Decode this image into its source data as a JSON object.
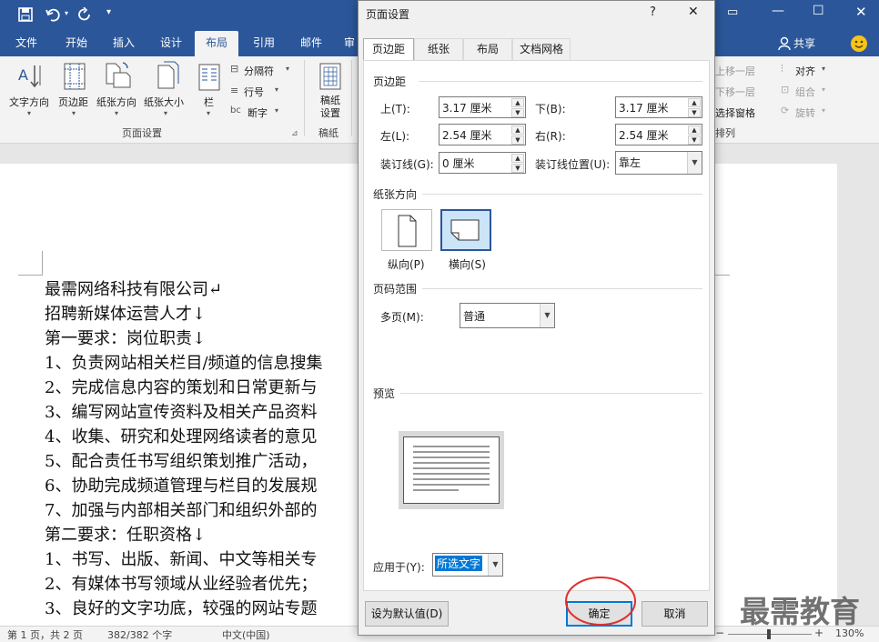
{
  "ribbon_tabs": [
    "文件",
    "开始",
    "插入",
    "设计",
    "布局",
    "引用",
    "邮件",
    "审阅"
  ],
  "share_label": "共享",
  "ribbon": {
    "text_direction": "文字方向",
    "margins": "页边距",
    "orientation": "纸张方向",
    "size": "纸张大小",
    "columns": "栏",
    "breaks": "分隔符",
    "line_numbers": "行号",
    "hyphenation": "断字",
    "manuscript": "稿纸设置",
    "group_page_setup": "页面设置",
    "group_manuscript": "稿纸",
    "bring_forward": "上移一层",
    "send_backward": "下移一层",
    "selection_pane": "选择窗格",
    "align": "对齐",
    "group": "组合",
    "rotate": "旋转",
    "group_arrange": "排列"
  },
  "document_lines": [
    "最需网络科技有限公司↵",
    "招聘新媒体运营人才↓",
    "第一要求：岗位职责↓",
    "1、负责网站相关栏目/频道的信息搜集",
    "2、完成信息内容的策划和日常更新与",
    "3、编写网站宣传资料及相关产品资料",
    "4、收集、研究和处理网络读者的意见",
    "5、配合责任书写组织策划推广活动，",
    "6、协助完成频道管理与栏目的发展规",
    "7、加强与内部相关部门和组织外部的",
    "第二要求：任职资格↓",
    "1、书写、出版、新闻、中文等相关专",
    "2、有媒体书写领域从业经验者优先；",
    "3、良好的文字功底，较强的网站专题"
  ],
  "status": {
    "page": "第 1 页，共 2 页",
    "words": "382/382 个字",
    "language": "中文(中国)",
    "zoom": "130%",
    "minus": "−",
    "plus": "+"
  },
  "watermark": "最需教育",
  "dialog": {
    "title": "页面设置",
    "help": "?",
    "close": "✕",
    "tabs": [
      "页边距",
      "纸张",
      "布局",
      "文档网格"
    ],
    "margins_section": "页边距",
    "top_label": "上(T):",
    "top_value": "3.17 厘米",
    "bottom_label": "下(B):",
    "bottom_value": "3.17 厘米",
    "left_label": "左(L):",
    "left_value": "2.54 厘米",
    "right_label": "右(R):",
    "right_value": "2.54 厘米",
    "gutter_label": "装订线(G):",
    "gutter_value": "0 厘米",
    "gutter_pos_label": "装订线位置(U):",
    "gutter_pos_value": "靠左",
    "orientation_section": "纸张方向",
    "portrait": "纵向(P)",
    "landscape": "横向(S)",
    "pages_section": "页码范围",
    "multiple_label": "多页(M):",
    "multiple_value": "普通",
    "preview_section": "预览",
    "apply_label": "应用于(Y):",
    "apply_value": "所选文字",
    "default_btn": "设为默认值(D)",
    "ok_btn": "确定",
    "cancel_btn": "取消"
  },
  "colors": {
    "accent": "#2b579a",
    "annotation": "#e0302e"
  }
}
